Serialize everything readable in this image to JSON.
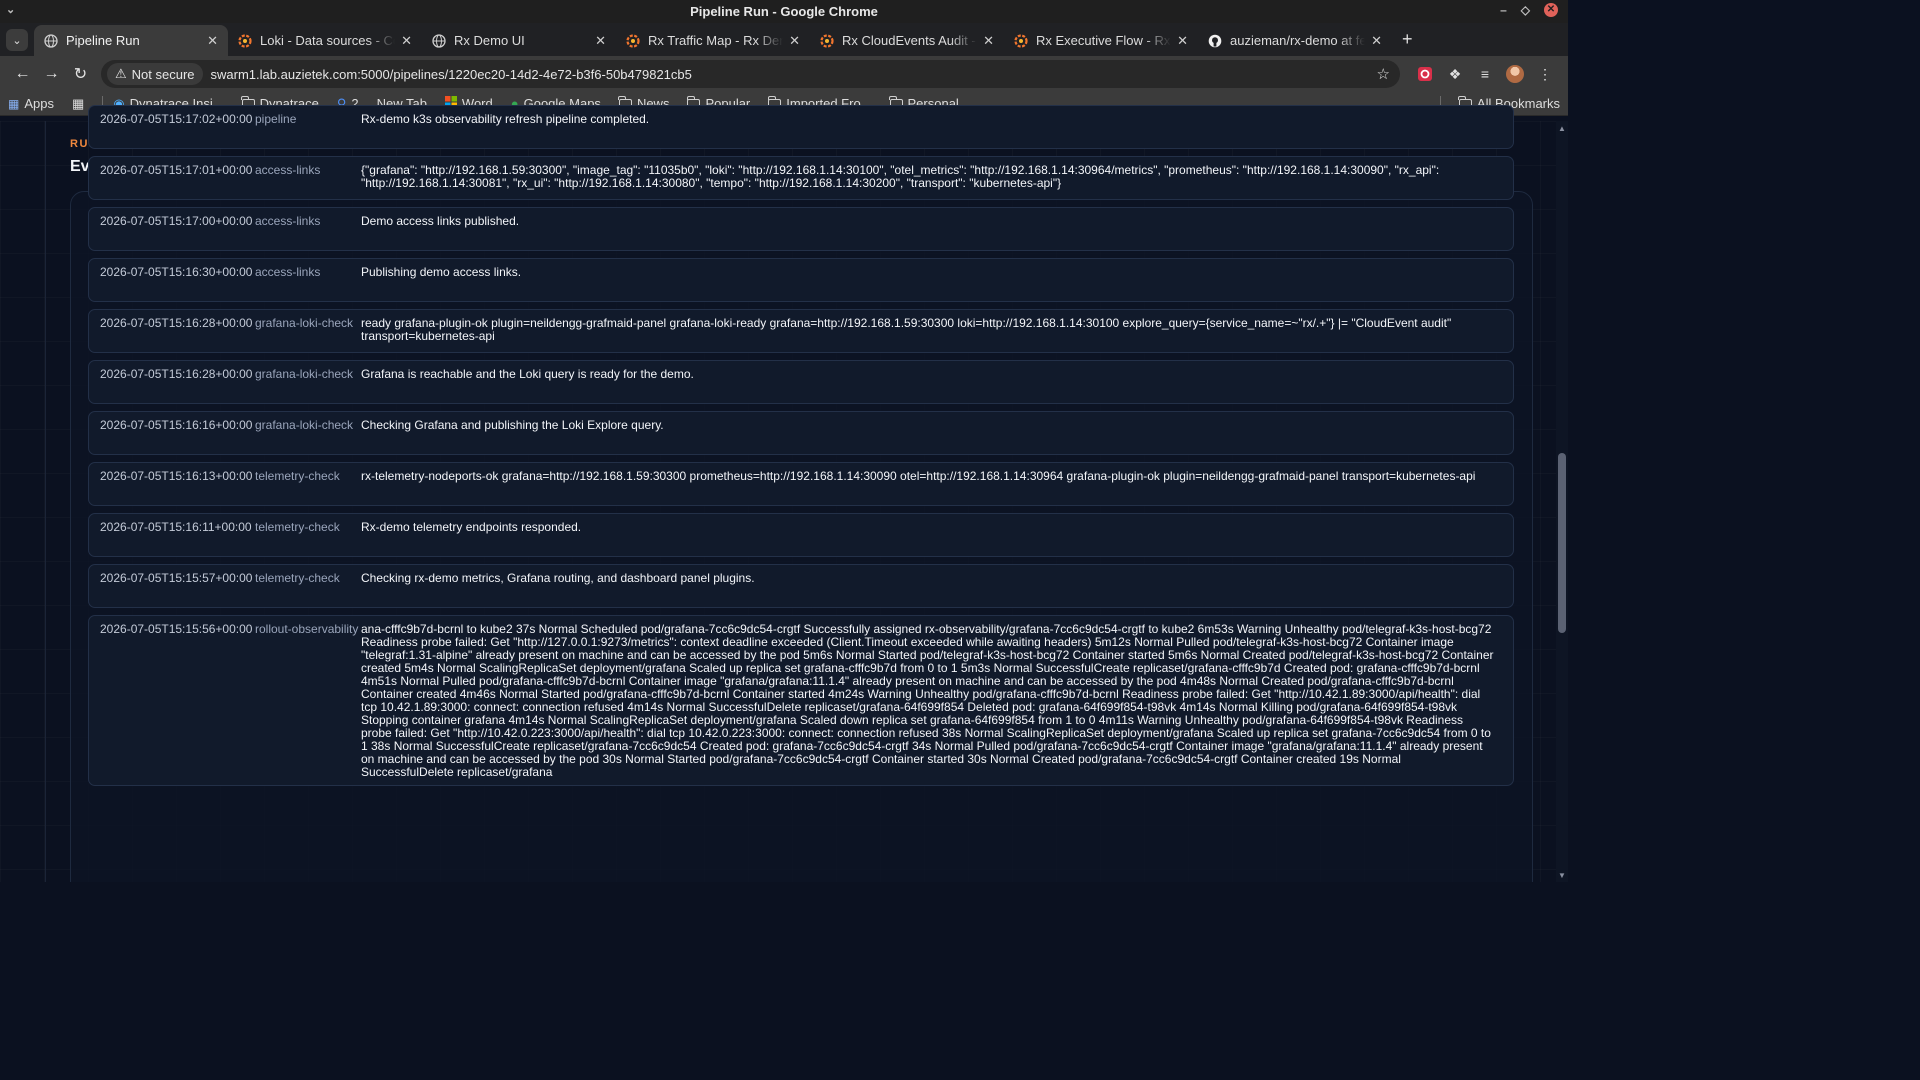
{
  "window": {
    "title": "Pipeline Run - Google Chrome"
  },
  "tabs": [
    {
      "title": "Pipeline Run",
      "icon": "globe-icon",
      "active": true
    },
    {
      "title": "Loki - Data sources - Connections",
      "icon": "grafana-icon"
    },
    {
      "title": "Rx Demo UI",
      "icon": "globe-icon"
    },
    {
      "title": "Rx Traffic Map - Rx Demo",
      "icon": "grafana-icon"
    },
    {
      "title": "Rx CloudEvents Audit - Rx",
      "icon": "grafana-icon"
    },
    {
      "title": "Rx Executive Flow - Rx Demo",
      "icon": "grafana-icon"
    },
    {
      "title": "auzieman/rx-demo at feature",
      "icon": "github-icon"
    }
  ],
  "toolbar": {
    "security_label": "Not secure",
    "url": "swarm1.lab.auzietek.com:5000/pipelines/1220ec20-14d2-4e72-b3f6-50b479821cb5"
  },
  "bookmarks": {
    "apps": "Apps",
    "items": [
      "Dynatrace Insi...",
      "Dynatrace",
      "2",
      "New Tab",
      "Word",
      "Google Maps",
      "News",
      "Popular",
      "Imported Fro...",
      "Personal"
    ],
    "all_bookmarks": "All Bookmarks"
  },
  "page": {
    "eyebrow": "RUN EVENTS",
    "title": "Event log"
  },
  "events": [
    {
      "time": "2026-07-05T15:17:02+00:00",
      "source": "pipeline",
      "message": "Rx-demo k3s observability refresh pipeline completed."
    },
    {
      "time": "2026-07-05T15:17:01+00:00",
      "source": "access-links",
      "message": "{\"grafana\": \"http://192.168.1.59:30300\", \"image_tag\": \"11035b0\", \"loki\": \"http://192.168.1.14:30100\", \"otel_metrics\": \"http://192.168.1.14:30964/metrics\", \"prometheus\": \"http://192.168.1.14:30090\", \"rx_api\": \"http://192.168.1.14:30081\", \"rx_ui\": \"http://192.168.1.14:30080\", \"tempo\": \"http://192.168.1.14:30200\", \"transport\": \"kubernetes-api\"}"
    },
    {
      "time": "2026-07-05T15:17:00+00:00",
      "source": "access-links",
      "message": "Demo access links published."
    },
    {
      "time": "2026-07-05T15:16:30+00:00",
      "source": "access-links",
      "message": "Publishing demo access links."
    },
    {
      "time": "2026-07-05T15:16:28+00:00",
      "source": "grafana-loki-check",
      "message": "ready grafana-plugin-ok plugin=neildengg-grafmaid-panel grafana-loki-ready grafana=http://192.168.1.59:30300 loki=http://192.168.1.14:30100 explore_query={service_name=~\"rx/.+\"} |= \"CloudEvent audit\" transport=kubernetes-api"
    },
    {
      "time": "2026-07-05T15:16:28+00:00",
      "source": "grafana-loki-check",
      "message": "Grafana is reachable and the Loki query is ready for the demo."
    },
    {
      "time": "2026-07-05T15:16:16+00:00",
      "source": "grafana-loki-check",
      "message": "Checking Grafana and publishing the Loki Explore query."
    },
    {
      "time": "2026-07-05T15:16:13+00:00",
      "source": "telemetry-check",
      "message": "rx-telemetry-nodeports-ok grafana=http://192.168.1.59:30300 prometheus=http://192.168.1.14:30090 otel=http://192.168.1.14:30964 grafana-plugin-ok plugin=neildengg-grafmaid-panel transport=kubernetes-api"
    },
    {
      "time": "2026-07-05T15:16:11+00:00",
      "source": "telemetry-check",
      "message": "Rx-demo telemetry endpoints responded."
    },
    {
      "time": "2026-07-05T15:15:57+00:00",
      "source": "telemetry-check",
      "message": "Checking rx-demo metrics, Grafana routing, and dashboard panel plugins."
    },
    {
      "time": "2026-07-05T15:15:56+00:00",
      "source": "rollout-observability",
      "message": "ana-cfffc9b7d-bcrnl to kube2 37s Normal Scheduled pod/grafana-7cc6c9dc54-crgtf Successfully assigned rx-observability/grafana-7cc6c9dc54-crgtf to kube2 6m53s Warning Unhealthy pod/telegraf-k3s-host-bcg72 Readiness probe failed: Get \"http://127.0.0.1:9273/metrics\": context deadline exceeded (Client.Timeout exceeded while awaiting headers) 5m12s Normal Pulled pod/telegraf-k3s-host-bcg72 Container image \"telegraf:1.31-alpine\" already present on machine and can be accessed by the pod 5m6s Normal Started pod/telegraf-k3s-host-bcg72 Container started 5m6s Normal Created pod/telegraf-k3s-host-bcg72 Container created 5m4s Normal ScalingReplicaSet deployment/grafana Scaled up replica set grafana-cfffc9b7d from 0 to 1 5m3s Normal SuccessfulCreate replicaset/grafana-cfffc9b7d Created pod: grafana-cfffc9b7d-bcrnl 4m51s Normal Pulled pod/grafana-cfffc9b7d-bcrnl Container image \"grafana/grafana:11.1.4\" already present on machine and can be accessed by the pod 4m48s Normal Created pod/grafana-cfffc9b7d-bcrnl Container created 4m46s Normal Started pod/grafana-cfffc9b7d-bcrnl Container started 4m24s Warning Unhealthy pod/grafana-cfffc9b7d-bcrnl Readiness probe failed: Get \"http://10.42.1.89:3000/api/health\": dial tcp 10.42.1.89:3000: connect: connection refused 4m14s Normal SuccessfulDelete replicaset/grafana-64f699f854 Deleted pod: grafana-64f699f854-t98vk 4m14s Normal Killing pod/grafana-64f699f854-t98vk Stopping container grafana 4m14s Normal ScalingReplicaSet deployment/grafana Scaled down replica set grafana-64f699f854 from 1 to 0 4m11s Warning Unhealthy pod/grafana-64f699f854-t98vk Readiness probe failed: Get \"http://10.42.0.223:3000/api/health\": dial tcp 10.42.0.223:3000: connect: connection refused 38s Normal ScalingReplicaSet deployment/grafana Scaled up replica set grafana-7cc6c9dc54 from 0 to 1 38s Normal SuccessfulCreate replicaset/grafana-7cc6c9dc54 Created pod: grafana-7cc6c9dc54-crgtf 34s Normal Pulled pod/grafana-7cc6c9dc54-crgtf Container image \"grafana/grafana:11.1.4\" already present on machine and can be accessed by the pod 30s Normal Started pod/grafana-7cc6c9dc54-crgtf Container started 30s Normal Created pod/grafana-7cc6c9dc54-crgtf Container created 19s Normal SuccessfulDelete replicaset/grafana"
    }
  ]
}
